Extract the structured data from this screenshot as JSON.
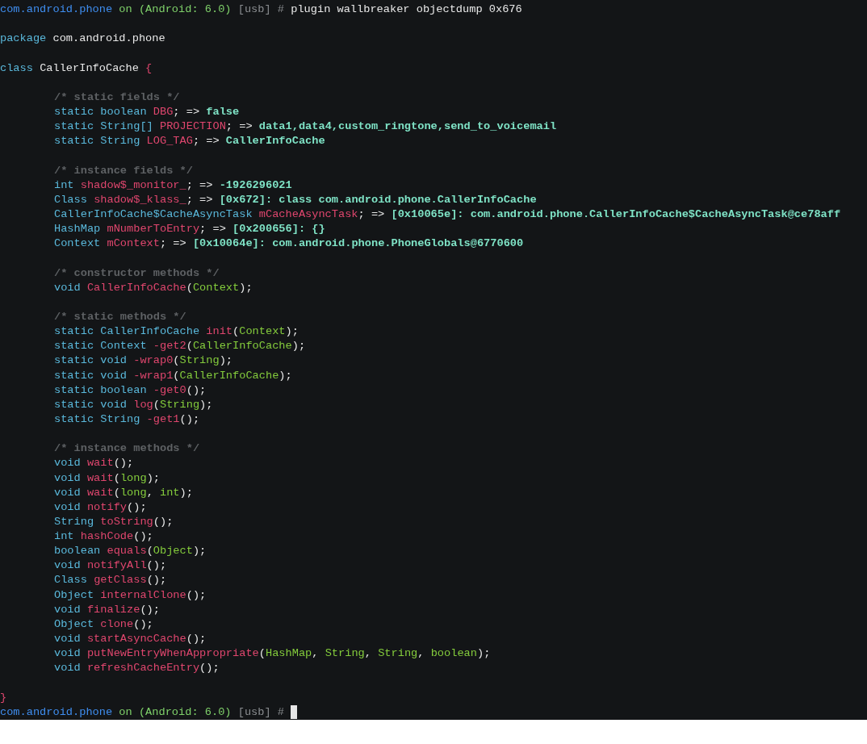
{
  "terminal": {
    "lines": [
      {
        "kind": "code",
        "segments": [
          {
            "kind": "host",
            "text": "com.android.phone"
          },
          {
            "kind": "on",
            "text": " on (Android: 6.0)"
          },
          {
            "kind": "dim",
            "text": " [usb] #"
          },
          {
            "kind": "plain",
            "text": " plugin wallbreaker objectdump 0x676"
          }
        ]
      },
      {
        "kind": "blank"
      },
      {
        "kind": "code",
        "segments": [
          {
            "kind": "kw",
            "text": "package "
          },
          {
            "kind": "plain",
            "text": "com.android.phone"
          }
        ]
      },
      {
        "kind": "blank"
      },
      {
        "kind": "code",
        "segments": [
          {
            "kind": "kw",
            "text": "class "
          },
          {
            "kind": "plain",
            "text": "CallerInfoCache "
          },
          {
            "kind": "name",
            "text": "{"
          }
        ]
      },
      {
        "kind": "blank"
      },
      {
        "kind": "code",
        "indent": true,
        "segments": [
          {
            "kind": "comment",
            "text": "/* static fields */"
          }
        ]
      },
      {
        "kind": "code",
        "indent": true,
        "segments": [
          {
            "kind": "kw",
            "text": "static boolean "
          },
          {
            "kind": "name",
            "text": "DBG"
          },
          {
            "kind": "plain",
            "text": "; => "
          },
          {
            "kind": "value",
            "text": "false"
          }
        ]
      },
      {
        "kind": "code",
        "indent": true,
        "segments": [
          {
            "kind": "kw",
            "text": "static String[] "
          },
          {
            "kind": "name",
            "text": "PROJECTION"
          },
          {
            "kind": "plain",
            "text": "; => "
          },
          {
            "kind": "value",
            "text": "data1,data4,custom_ringtone,send_to_voicemail"
          }
        ]
      },
      {
        "kind": "code",
        "indent": true,
        "segments": [
          {
            "kind": "kw",
            "text": "static String "
          },
          {
            "kind": "name",
            "text": "LOG_TAG"
          },
          {
            "kind": "plain",
            "text": "; => "
          },
          {
            "kind": "value",
            "text": "CallerInfoCache"
          }
        ]
      },
      {
        "kind": "blank"
      },
      {
        "kind": "code",
        "indent": true,
        "segments": [
          {
            "kind": "comment",
            "text": "/* instance fields */"
          }
        ]
      },
      {
        "kind": "code",
        "indent": true,
        "segments": [
          {
            "kind": "kw",
            "text": "int "
          },
          {
            "kind": "name",
            "text": "shadow$_monitor_"
          },
          {
            "kind": "plain",
            "text": "; => "
          },
          {
            "kind": "value",
            "text": "-1926296021"
          }
        ]
      },
      {
        "kind": "code",
        "indent": true,
        "segments": [
          {
            "kind": "kw",
            "text": "Class "
          },
          {
            "kind": "name",
            "text": "shadow$_klass_"
          },
          {
            "kind": "plain",
            "text": "; => "
          },
          {
            "kind": "value",
            "text": "[0x672]: class com.android.phone.CallerInfoCache"
          }
        ]
      },
      {
        "kind": "code",
        "indent": true,
        "segments": [
          {
            "kind": "kw",
            "text": "CallerInfoCache$CacheAsyncTask "
          },
          {
            "kind": "name",
            "text": "mCacheAsyncTask"
          },
          {
            "kind": "plain",
            "text": "; => "
          },
          {
            "kind": "value",
            "text": "[0x10065e]: com.android.phone.CallerInfoCache$CacheAsyncTask@ce78aff"
          }
        ]
      },
      {
        "kind": "code",
        "indent": true,
        "segments": [
          {
            "kind": "kw",
            "text": "HashMap "
          },
          {
            "kind": "name",
            "text": "mNumberToEntry"
          },
          {
            "kind": "plain",
            "text": "; => "
          },
          {
            "kind": "value",
            "text": "[0x200656]: {}"
          }
        ]
      },
      {
        "kind": "code",
        "indent": true,
        "segments": [
          {
            "kind": "kw",
            "text": "Context "
          },
          {
            "kind": "name",
            "text": "mContext"
          },
          {
            "kind": "plain",
            "text": "; => "
          },
          {
            "kind": "value",
            "text": "[0x10064e]: com.android.phone.PhoneGlobals@6770600"
          }
        ]
      },
      {
        "kind": "blank"
      },
      {
        "kind": "code",
        "indent": true,
        "segments": [
          {
            "kind": "comment",
            "text": "/* constructor methods */"
          }
        ]
      },
      {
        "kind": "code",
        "indent": true,
        "segments": [
          {
            "kind": "kw",
            "text": "void "
          },
          {
            "kind": "name",
            "text": "CallerInfoCache"
          },
          {
            "kind": "plain",
            "text": "("
          },
          {
            "kind": "arg",
            "text": "Context"
          },
          {
            "kind": "plain",
            "text": ");"
          }
        ]
      },
      {
        "kind": "blank"
      },
      {
        "kind": "code",
        "indent": true,
        "segments": [
          {
            "kind": "comment",
            "text": "/* static methods */"
          }
        ]
      },
      {
        "kind": "code",
        "indent": true,
        "segments": [
          {
            "kind": "kw",
            "text": "static CallerInfoCache "
          },
          {
            "kind": "name",
            "text": "init"
          },
          {
            "kind": "plain",
            "text": "("
          },
          {
            "kind": "arg",
            "text": "Context"
          },
          {
            "kind": "plain",
            "text": ");"
          }
        ]
      },
      {
        "kind": "code",
        "indent": true,
        "segments": [
          {
            "kind": "kw",
            "text": "static Context "
          },
          {
            "kind": "name",
            "text": "-get2"
          },
          {
            "kind": "plain",
            "text": "("
          },
          {
            "kind": "arg",
            "text": "CallerInfoCache"
          },
          {
            "kind": "plain",
            "text": ");"
          }
        ]
      },
      {
        "kind": "code",
        "indent": true,
        "segments": [
          {
            "kind": "kw",
            "text": "static void "
          },
          {
            "kind": "name",
            "text": "-wrap0"
          },
          {
            "kind": "plain",
            "text": "("
          },
          {
            "kind": "arg",
            "text": "String"
          },
          {
            "kind": "plain",
            "text": ");"
          }
        ]
      },
      {
        "kind": "code",
        "indent": true,
        "segments": [
          {
            "kind": "kw",
            "text": "static void "
          },
          {
            "kind": "name",
            "text": "-wrap1"
          },
          {
            "kind": "plain",
            "text": "("
          },
          {
            "kind": "arg",
            "text": "CallerInfoCache"
          },
          {
            "kind": "plain",
            "text": ");"
          }
        ]
      },
      {
        "kind": "code",
        "indent": true,
        "segments": [
          {
            "kind": "kw",
            "text": "static boolean "
          },
          {
            "kind": "name",
            "text": "-get0"
          },
          {
            "kind": "plain",
            "text": "();"
          }
        ]
      },
      {
        "kind": "code",
        "indent": true,
        "segments": [
          {
            "kind": "kw",
            "text": "static void "
          },
          {
            "kind": "name",
            "text": "log"
          },
          {
            "kind": "plain",
            "text": "("
          },
          {
            "kind": "arg",
            "text": "String"
          },
          {
            "kind": "plain",
            "text": ");"
          }
        ]
      },
      {
        "kind": "code",
        "indent": true,
        "segments": [
          {
            "kind": "kw",
            "text": "static String "
          },
          {
            "kind": "name",
            "text": "-get1"
          },
          {
            "kind": "plain",
            "text": "();"
          }
        ]
      },
      {
        "kind": "blank"
      },
      {
        "kind": "code",
        "indent": true,
        "segments": [
          {
            "kind": "comment",
            "text": "/* instance methods */"
          }
        ]
      },
      {
        "kind": "code",
        "indent": true,
        "segments": [
          {
            "kind": "kw",
            "text": "void "
          },
          {
            "kind": "name",
            "text": "wait"
          },
          {
            "kind": "plain",
            "text": "();"
          }
        ]
      },
      {
        "kind": "code",
        "indent": true,
        "segments": [
          {
            "kind": "kw",
            "text": "void "
          },
          {
            "kind": "name",
            "text": "wait"
          },
          {
            "kind": "plain",
            "text": "("
          },
          {
            "kind": "arg",
            "text": "long"
          },
          {
            "kind": "plain",
            "text": ");"
          }
        ]
      },
      {
        "kind": "code",
        "indent": true,
        "segments": [
          {
            "kind": "kw",
            "text": "void "
          },
          {
            "kind": "name",
            "text": "wait"
          },
          {
            "kind": "plain",
            "text": "("
          },
          {
            "kind": "arg",
            "text": "long"
          },
          {
            "kind": "plain",
            "text": ", "
          },
          {
            "kind": "arg",
            "text": "int"
          },
          {
            "kind": "plain",
            "text": ");"
          }
        ]
      },
      {
        "kind": "code",
        "indent": true,
        "segments": [
          {
            "kind": "kw",
            "text": "void "
          },
          {
            "kind": "name",
            "text": "notify"
          },
          {
            "kind": "plain",
            "text": "();"
          }
        ]
      },
      {
        "kind": "code",
        "indent": true,
        "segments": [
          {
            "kind": "kw",
            "text": "String "
          },
          {
            "kind": "name",
            "text": "toString"
          },
          {
            "kind": "plain",
            "text": "();"
          }
        ]
      },
      {
        "kind": "code",
        "indent": true,
        "segments": [
          {
            "kind": "kw",
            "text": "int "
          },
          {
            "kind": "name",
            "text": "hashCode"
          },
          {
            "kind": "plain",
            "text": "();"
          }
        ]
      },
      {
        "kind": "code",
        "indent": true,
        "segments": [
          {
            "kind": "kw",
            "text": "boolean "
          },
          {
            "kind": "name",
            "text": "equals"
          },
          {
            "kind": "plain",
            "text": "("
          },
          {
            "kind": "arg",
            "text": "Object"
          },
          {
            "kind": "plain",
            "text": ");"
          }
        ]
      },
      {
        "kind": "code",
        "indent": true,
        "segments": [
          {
            "kind": "kw",
            "text": "void "
          },
          {
            "kind": "name",
            "text": "notifyAll"
          },
          {
            "kind": "plain",
            "text": "();"
          }
        ]
      },
      {
        "kind": "code",
        "indent": true,
        "segments": [
          {
            "kind": "kw",
            "text": "Class "
          },
          {
            "kind": "name",
            "text": "getClass"
          },
          {
            "kind": "plain",
            "text": "();"
          }
        ]
      },
      {
        "kind": "code",
        "indent": true,
        "segments": [
          {
            "kind": "kw",
            "text": "Object "
          },
          {
            "kind": "name",
            "text": "internalClone"
          },
          {
            "kind": "plain",
            "text": "();"
          }
        ]
      },
      {
        "kind": "code",
        "indent": true,
        "segments": [
          {
            "kind": "kw",
            "text": "void "
          },
          {
            "kind": "name",
            "text": "finalize"
          },
          {
            "kind": "plain",
            "text": "();"
          }
        ]
      },
      {
        "kind": "code",
        "indent": true,
        "segments": [
          {
            "kind": "kw",
            "text": "Object "
          },
          {
            "kind": "name",
            "text": "clone"
          },
          {
            "kind": "plain",
            "text": "();"
          }
        ]
      },
      {
        "kind": "code",
        "indent": true,
        "segments": [
          {
            "kind": "kw",
            "text": "void "
          },
          {
            "kind": "name",
            "text": "startAsyncCache"
          },
          {
            "kind": "plain",
            "text": "();"
          }
        ]
      },
      {
        "kind": "code",
        "indent": true,
        "segments": [
          {
            "kind": "kw",
            "text": "void "
          },
          {
            "kind": "name",
            "text": "putNewEntryWhenAppropriate"
          },
          {
            "kind": "plain",
            "text": "("
          },
          {
            "kind": "arg",
            "text": "HashMap"
          },
          {
            "kind": "plain",
            "text": ", "
          },
          {
            "kind": "arg",
            "text": "String"
          },
          {
            "kind": "plain",
            "text": ", "
          },
          {
            "kind": "arg",
            "text": "String"
          },
          {
            "kind": "plain",
            "text": ", "
          },
          {
            "kind": "arg",
            "text": "boolean"
          },
          {
            "kind": "plain",
            "text": ");"
          }
        ]
      },
      {
        "kind": "code",
        "indent": true,
        "segments": [
          {
            "kind": "kw",
            "text": "void "
          },
          {
            "kind": "name",
            "text": "refreshCacheEntry"
          },
          {
            "kind": "plain",
            "text": "();"
          }
        ]
      },
      {
        "kind": "blank"
      },
      {
        "kind": "code",
        "segments": [
          {
            "kind": "name",
            "text": "}"
          }
        ]
      },
      {
        "kind": "code",
        "cursor": true,
        "segments": [
          {
            "kind": "host",
            "text": "com.android.phone"
          },
          {
            "kind": "on",
            "text": " on (Android: 6.0)"
          },
          {
            "kind": "dim",
            "text": " [usb] #"
          }
        ]
      }
    ]
  }
}
